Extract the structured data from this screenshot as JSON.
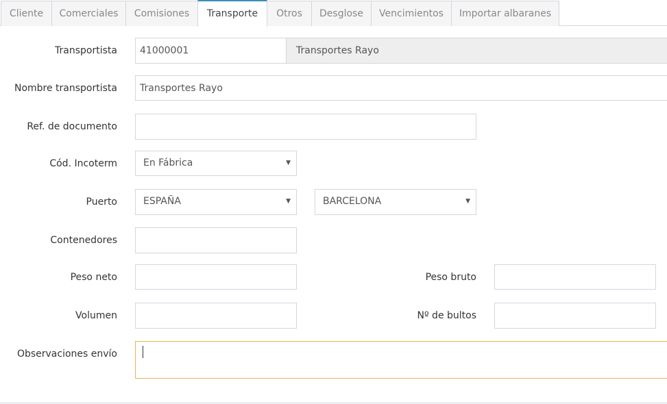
{
  "tabs": [
    {
      "label": "Cliente",
      "active": false
    },
    {
      "label": "Comerciales",
      "active": false
    },
    {
      "label": "Comisiones",
      "active": false
    },
    {
      "label": "Transporte",
      "active": true
    },
    {
      "label": "Otros",
      "active": false
    },
    {
      "label": "Desglose",
      "active": false
    },
    {
      "label": "Vencimientos",
      "active": false
    },
    {
      "label": "Importar albaranes",
      "active": false
    }
  ],
  "form": {
    "transportista": {
      "label": "Transportista",
      "code": "41000001",
      "name": "Transportes Rayo"
    },
    "nombre_transportista": {
      "label": "Nombre transportista",
      "value": "Transportes Rayo"
    },
    "ref_documento": {
      "label": "Ref. de documento",
      "value": ""
    },
    "cod_incoterm": {
      "label": "Cód. Incoterm",
      "selected": "En Fábrica"
    },
    "puerto": {
      "label": "Puerto",
      "country": "ESPAÑA",
      "port": "BARCELONA"
    },
    "contenedores": {
      "label": "Contenedores",
      "value": ""
    },
    "peso_neto": {
      "label": "Peso neto",
      "value": ""
    },
    "peso_bruto": {
      "label": "Peso bruto",
      "value": ""
    },
    "volumen": {
      "label": "Volumen",
      "value": ""
    },
    "num_bultos": {
      "label": "Nº de bultos",
      "value": ""
    },
    "observaciones_envio": {
      "label": "Observaciones envío",
      "value": ""
    }
  },
  "icons": {
    "dropdown_arrow": "▼"
  },
  "colors": {
    "accent": "#3c8dbc",
    "focus_border": "#e6b554",
    "border": "#d2d6de",
    "readonly_bg": "#eeeeee"
  }
}
